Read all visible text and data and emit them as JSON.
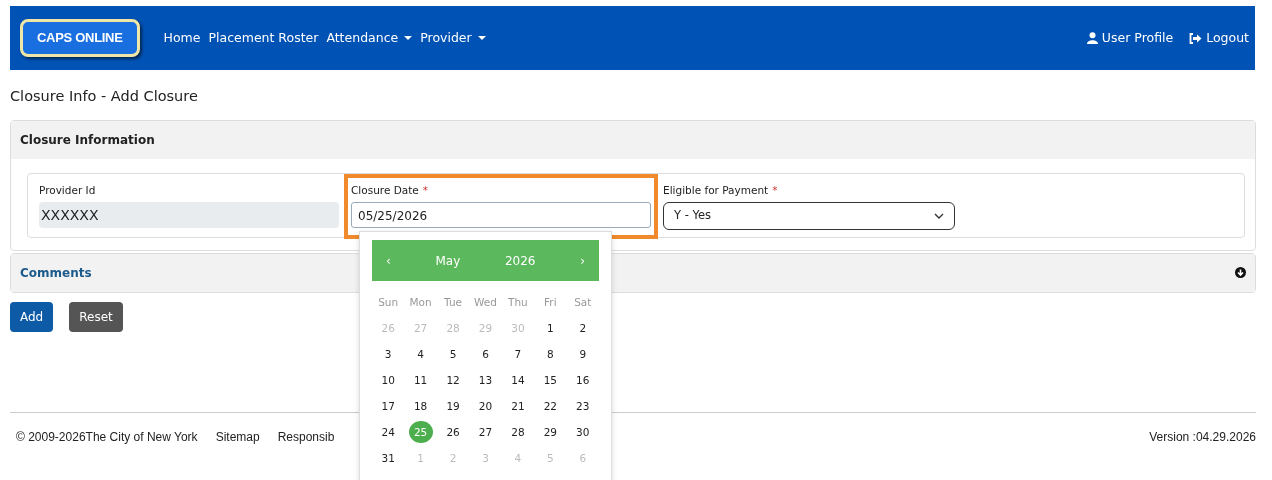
{
  "navbar": {
    "logo": "CAPS ONLINE",
    "links": [
      {
        "label": "Home",
        "dropdown": false
      },
      {
        "label": "Placement Roster",
        "dropdown": false
      },
      {
        "label": "Attendance",
        "dropdown": true
      },
      {
        "label": "Provider",
        "dropdown": true
      }
    ],
    "right_links": [
      {
        "label": "User Profile"
      },
      {
        "label": "Logout"
      }
    ]
  },
  "page_title": "Closure Info - Add Closure",
  "closure_section": {
    "title": "Closure Information",
    "fields": [
      {
        "label": "Provider Id",
        "kind": "readonly",
        "value": "XXXXXX",
        "highlighted": false
      },
      {
        "label": "Closure Date",
        "required_mark": "*",
        "kind": "text",
        "value": "05/25/2026",
        "highlighted": true
      },
      {
        "label": "Eligible for Payment",
        "required_mark": "*",
        "kind": "select",
        "value": "Y - Yes",
        "highlighted": false
      }
    ]
  },
  "comments_section": {
    "title": "Comments",
    "expanded": false
  },
  "buttons": [
    {
      "label": "Add",
      "kind": "primary"
    },
    {
      "label": "Reset",
      "kind": "secondary"
    }
  ],
  "datepicker": {
    "month": "May",
    "year": "2026",
    "prev": "‹",
    "next": "›",
    "weekdays": [
      "Sun",
      "Mon",
      "Tue",
      "Wed",
      "Thu",
      "Fri",
      "Sat"
    ],
    "weeks": [
      [
        {
          "day": "26",
          "muted": true,
          "selected": false
        },
        {
          "day": "27",
          "muted": true,
          "selected": false
        },
        {
          "day": "28",
          "muted": true,
          "selected": false
        },
        {
          "day": "29",
          "muted": true,
          "selected": false
        },
        {
          "day": "30",
          "muted": true,
          "selected": false
        },
        {
          "day": "1",
          "muted": false,
          "selected": false
        },
        {
          "day": "2",
          "muted": false,
          "selected": false
        }
      ],
      [
        {
          "day": "3",
          "muted": false,
          "selected": false
        },
        {
          "day": "4",
          "muted": false,
          "selected": false
        },
        {
          "day": "5",
          "muted": false,
          "selected": false
        },
        {
          "day": "6",
          "muted": false,
          "selected": false
        },
        {
          "day": "7",
          "muted": false,
          "selected": false
        },
        {
          "day": "8",
          "muted": false,
          "selected": false
        },
        {
          "day": "9",
          "muted": false,
          "selected": false
        }
      ],
      [
        {
          "day": "10",
          "muted": false,
          "selected": false
        },
        {
          "day": "11",
          "muted": false,
          "selected": false
        },
        {
          "day": "12",
          "muted": false,
          "selected": false
        },
        {
          "day": "13",
          "muted": false,
          "selected": false
        },
        {
          "day": "14",
          "muted": false,
          "selected": false
        },
        {
          "day": "15",
          "muted": false,
          "selected": false
        },
        {
          "day": "16",
          "muted": false,
          "selected": false
        }
      ],
      [
        {
          "day": "17",
          "muted": false,
          "selected": false
        },
        {
          "day": "18",
          "muted": false,
          "selected": false
        },
        {
          "day": "19",
          "muted": false,
          "selected": false
        },
        {
          "day": "20",
          "muted": false,
          "selected": false
        },
        {
          "day": "21",
          "muted": false,
          "selected": false
        },
        {
          "day": "22",
          "muted": false,
          "selected": false
        },
        {
          "day": "23",
          "muted": false,
          "selected": false
        }
      ],
      [
        {
          "day": "24",
          "muted": false,
          "selected": false
        },
        {
          "day": "25",
          "muted": false,
          "selected": true
        },
        {
          "day": "26",
          "muted": false,
          "selected": false
        },
        {
          "day": "27",
          "muted": false,
          "selected": false
        },
        {
          "day": "28",
          "muted": false,
          "selected": false
        },
        {
          "day": "29",
          "muted": false,
          "selected": false
        },
        {
          "day": "30",
          "muted": false,
          "selected": false
        }
      ],
      [
        {
          "day": "31",
          "muted": false,
          "selected": false
        },
        {
          "day": "1",
          "muted": true,
          "selected": false
        },
        {
          "day": "2",
          "muted": true,
          "selected": false
        },
        {
          "day": "3",
          "muted": true,
          "selected": false
        },
        {
          "day": "4",
          "muted": true,
          "selected": false
        },
        {
          "day": "5",
          "muted": true,
          "selected": false
        },
        {
          "day": "6",
          "muted": true,
          "selected": false
        }
      ]
    ]
  },
  "footer": {
    "copyright": "© 2009-2026",
    "links": [
      "The City of New York",
      "Sitemap",
      "Responsib"
    ],
    "version": "Version :04.29.2026"
  }
}
